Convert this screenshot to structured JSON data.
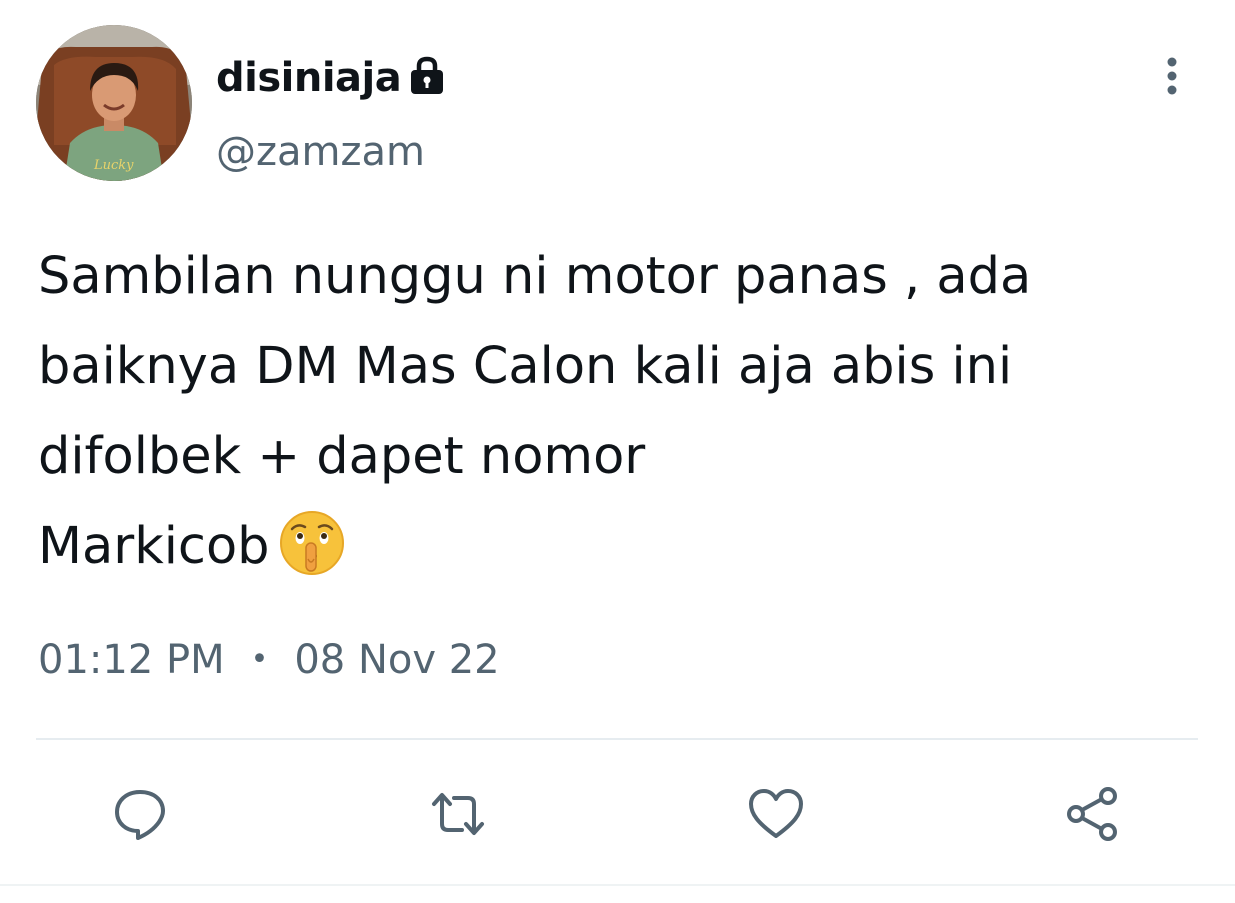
{
  "tweet": {
    "author": {
      "display_name": "disiniaja",
      "handle": "@zamzam",
      "avatar_shirt_text": "Lucky",
      "protected_icon": "lock-icon"
    },
    "text_lines": [
      "Sambilan nunggu ni motor panas , ada",
      "baiknya DM Mas Calon kali aja abis ini",
      "difolbek + dapet nomor",
      "Markicob"
    ],
    "emoji": "shushing-face",
    "time": "01:12 PM",
    "separator": "•",
    "date": "08 Nov 22"
  },
  "header": {
    "more_icon": "more-vertical-icon"
  },
  "actions": {
    "reply_icon": "reply-icon",
    "retweet_icon": "retweet-icon",
    "like_icon": "heart-icon",
    "share_icon": "share-icon"
  },
  "colors": {
    "text": "#0f1419",
    "muted": "#536471",
    "divider": "#e6ecf0",
    "emoji_face": "#f7c23b"
  }
}
